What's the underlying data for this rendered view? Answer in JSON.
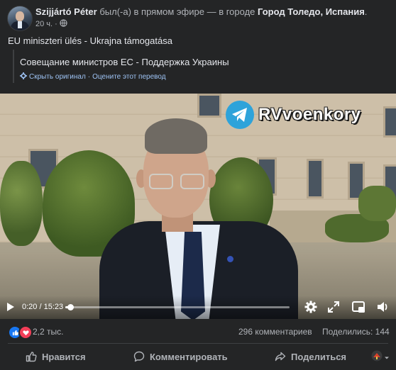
{
  "post": {
    "author": "Szijjártó Péter",
    "action_text": " был(-а) в прямом эфире — в городе ",
    "location": "Город Толедо, Испания",
    "title_suffix": ".",
    "time": "20 ч.",
    "privacy_icon": "globe-icon",
    "text": "EU miniszteri ülés - Ukrajna támogatása"
  },
  "translation": {
    "text": "Совещание министров ЕС - Поддержка Украины",
    "hide_original": "Скрыть оригинал",
    "separator": "·",
    "rate": "Оцените этот перевод"
  },
  "video": {
    "watermark": "RVvoenkory",
    "current_time": "0:20",
    "duration": "15:23",
    "time_separator": " / ",
    "progress_fraction": 0.022
  },
  "stats": {
    "reactions": "2,2 тыс.",
    "comments": "296 комментариев",
    "shares": "Поделились: 144"
  },
  "actions": {
    "like": "Нравится",
    "comment": "Комментировать",
    "share": "Поделиться"
  },
  "colors": {
    "background": "#242526",
    "text_primary": "#e4e6eb",
    "text_secondary": "#b0b3b8",
    "link": "#9ec3f4",
    "like_blue": "#1877f2",
    "love_red": "#f33e58",
    "telegram_blue": "#2ea3da"
  }
}
